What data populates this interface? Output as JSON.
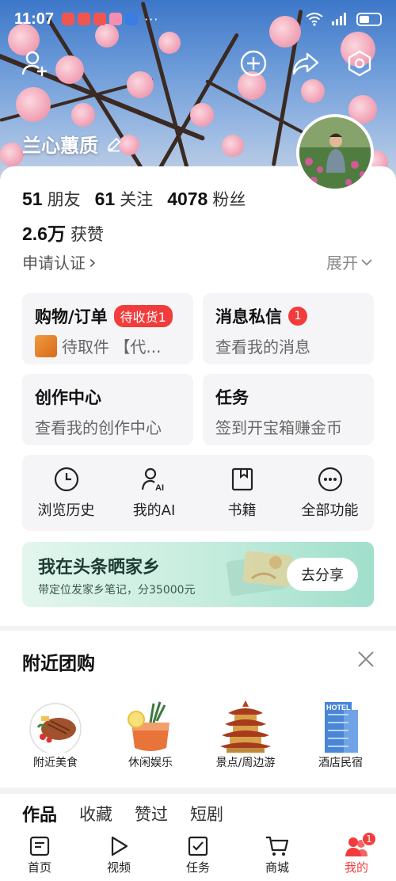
{
  "status_bar": {
    "time": "11:07",
    "dots": "···",
    "app_colors": [
      "#f0564f",
      "#f0564f",
      "#f0564f",
      "#f48fb1",
      "#3b7de3"
    ]
  },
  "profile": {
    "username": "兰心蕙质"
  },
  "stats": {
    "friends_count": "51",
    "friends_label": "朋友",
    "following_count": "61",
    "following_label": "关注",
    "followers_count": "4078",
    "followers_label": "粉丝",
    "likes_count": "2.6万",
    "likes_label": "获赞"
  },
  "verify": {
    "label": "申请认证",
    "chevron": "›"
  },
  "expand": {
    "label": "展开",
    "chevron": "⌄"
  },
  "tiles": {
    "orders": {
      "title": "购物/订单",
      "badge": "待收货1",
      "subtitle": "待取件 【代..."
    },
    "messages": {
      "title": "消息私信",
      "badge": "1",
      "subtitle": "查看我的消息"
    },
    "creator": {
      "title": "创作中心",
      "subtitle": "查看我的创作中心"
    },
    "tasks": {
      "title": "任务",
      "subtitle": "签到开宝箱赚金币"
    }
  },
  "tools": [
    {
      "label": "浏览历史",
      "icon": "clock-icon"
    },
    {
      "label": "我的AI",
      "icon": "ai-person-icon"
    },
    {
      "label": "书籍",
      "icon": "book-icon"
    },
    {
      "label": "全部功能",
      "icon": "more-icon"
    }
  ],
  "promo": {
    "title": "我在头条晒家乡",
    "subtitle": "带定位发家乡笔记，分35000元",
    "button": "去分享"
  },
  "nearby": {
    "title": "附近团购",
    "categories": [
      {
        "label": "附近美食",
        "icon": "steak-dish-icon"
      },
      {
        "label": "休闲娱乐",
        "icon": "cocktail-icon"
      },
      {
        "label": "景点/周边游",
        "icon": "pagoda-icon"
      },
      {
        "label": "酒店民宿",
        "icon": "hotel-building-icon"
      }
    ],
    "hotel_sign": "HOTEL"
  },
  "content_tabs": [
    "作品",
    "收藏",
    "赞过",
    "短剧"
  ],
  "bottom_nav": [
    {
      "label": "首页",
      "icon": "home-icon"
    },
    {
      "label": "视频",
      "icon": "play-icon"
    },
    {
      "label": "任务",
      "icon": "task-check-icon"
    },
    {
      "label": "商城",
      "icon": "cart-icon"
    },
    {
      "label": "我的",
      "icon": "profile-icon",
      "badge": "1"
    }
  ],
  "colors": {
    "accent_red": "#f23c3c",
    "tile_bg": "#f5f5f7"
  }
}
